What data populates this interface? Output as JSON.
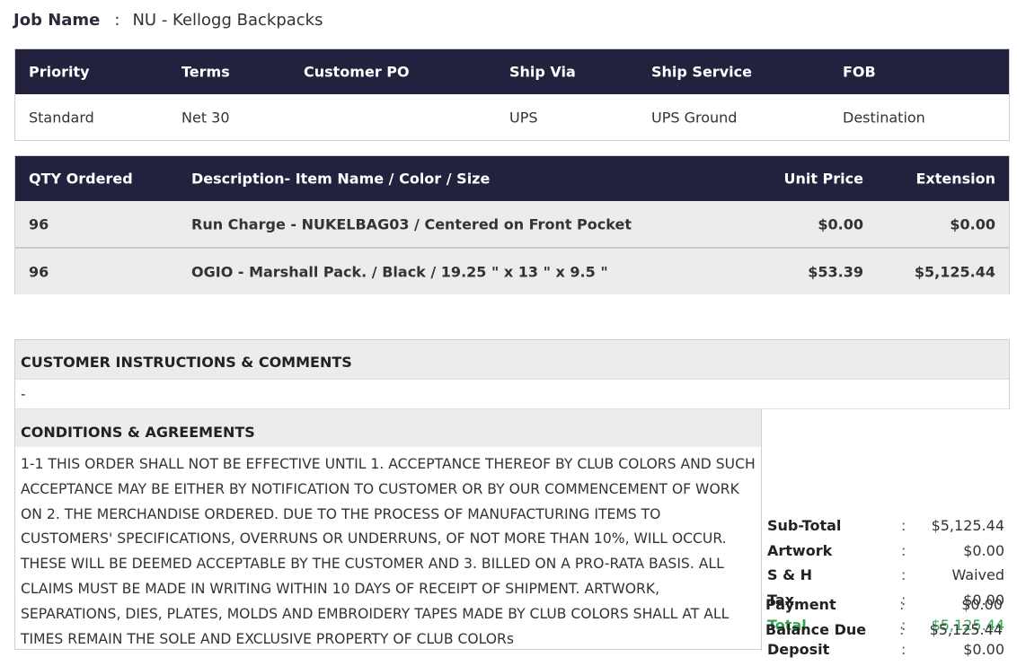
{
  "job": {
    "label": "Job Name",
    "separator": ":",
    "value": "NU - Kellogg Backpacks"
  },
  "shipping": {
    "headers": [
      "Priority",
      "Terms",
      "Customer PO",
      "Ship Via",
      "Ship Service",
      "FOB"
    ],
    "values": [
      "Standard",
      "Net 30",
      "",
      "UPS",
      "UPS Ground",
      "Destination"
    ]
  },
  "items": {
    "headers": [
      "QTY Ordered",
      "Description- Item Name / Color / Size",
      "Unit Price",
      "Extension"
    ],
    "rows": [
      {
        "qty": "96",
        "desc": "Run Charge - NUKELBAG03 / Centered on Front Pocket",
        "unit": "$0.00",
        "ext": "$0.00"
      },
      {
        "qty": "96",
        "desc": "OGIO - Marshall Pack. / Black / 19.25 \" x 13 \" x 9.5 \"",
        "unit": "$53.39",
        "ext": "$5,125.44"
      }
    ]
  },
  "customer_instructions": {
    "title": "CUSTOMER INSTRUCTIONS & COMMENTS",
    "text": "-"
  },
  "conditions": {
    "title": "CONDITIONS & AGREEMENTS",
    "lines": [
      "1-1 THIS ORDER SHALL NOT BE EFFECTIVE UNTIL 1. ACCEPTANCE THEREOF BY CLUB COLORS AND SUCH",
      "ACCEPTANCE MAY BE EITHER BY NOTIFICATION TO CUSTOMER OR BY OUR COMMENCEMENT OF WORK",
      "ON 2. THE MERCHANDISE ORDERED. DUE TO THE PROCESS OF MANUFACTURING ITEMS TO",
      "CUSTOMERS' SPECIFICATIONS, OVERRUNS OR UNDERRUNS, OF NOT MORE THAN 10%, WILL OCCUR.",
      "THESE WILL BE DEEMED ACCEPTABLE BY THE CUSTOMER AND 3. BILLED ON A PRO-RATA BASIS. ALL",
      "CLAIMS MUST BE MADE IN WRITING WITHIN 10 DAYS OF RECEIPT OF SHIPMENT. ARTWORK,",
      "SEPARATIONS, DIES, PLATES, MOLDS AND EMBROIDERY TAPES MADE BY CLUB COLORS SHALL AT ALL",
      "TIMES REMAIN THE SOLE AND EXCLUSIVE PROPERTY OF CLUB COLORs"
    ]
  },
  "totals": {
    "separator": ":",
    "rows": [
      {
        "label": "Sub-Total",
        "value": "$5,125.44"
      },
      {
        "label": "Artwork",
        "value": "$0.00"
      },
      {
        "label": "S & H",
        "value": "Waived"
      },
      {
        "label": "Tax",
        "value": "$0.00"
      },
      {
        "label": "Total",
        "value": "$5,125.44"
      },
      {
        "label": "Deposit",
        "value": "$0.00"
      },
      {
        "label": "Payment",
        "value": "$0.00"
      },
      {
        "label": "Balance Due",
        "value": "$5,125.44"
      }
    ]
  },
  "colors": {
    "header_bg": "#22223f",
    "total_green": "#2fa84f",
    "row_gray": "#ececec"
  }
}
